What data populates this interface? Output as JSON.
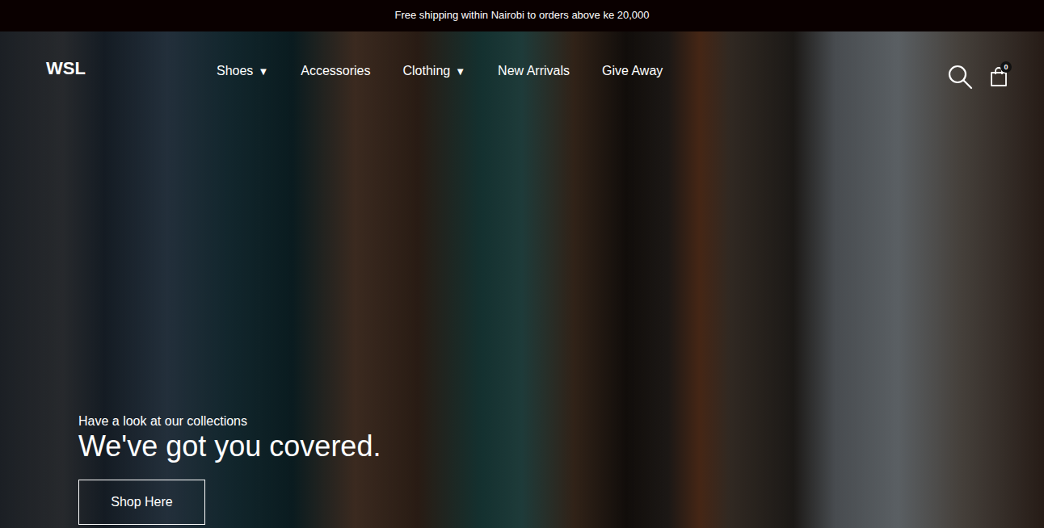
{
  "announcement": {
    "text": "Free shipping within Nairobi to orders above ke 20,000"
  },
  "header": {
    "logo": "WSL",
    "nav": [
      {
        "label": "Shoes",
        "caret": "▼"
      },
      {
        "label": "Accessories",
        "caret": ""
      },
      {
        "label": "Clothing",
        "caret": "▼"
      },
      {
        "label": "New Arrivals",
        "caret": ""
      },
      {
        "label": "Give Away",
        "caret": ""
      }
    ],
    "cart": {
      "count": "0"
    }
  },
  "hero": {
    "subtitle": "Have a look at our collections",
    "title": "We've got you covered.",
    "button": "Shop Here"
  }
}
